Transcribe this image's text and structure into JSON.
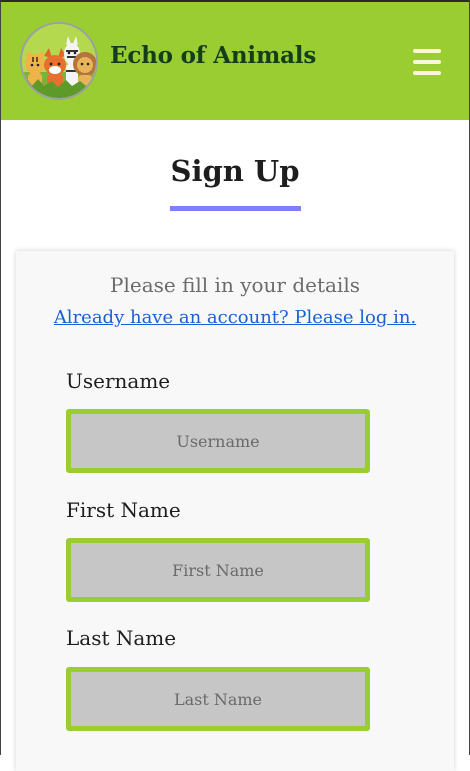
{
  "navbar": {
    "brand": "Echo of Animals",
    "logo_icon": "animals-logo-icon",
    "menu_icon": "hamburger-menu-icon",
    "color": "#9acd32"
  },
  "page": {
    "title": "Sign Up",
    "underline_color": "#7f7ff7"
  },
  "form": {
    "intro": "Please fill in your details",
    "login_link": "Already have an account? Please log in.",
    "fields": [
      {
        "label": "Username",
        "placeholder": "Username",
        "value": ""
      },
      {
        "label": "First Name",
        "placeholder": "First Name",
        "value": ""
      },
      {
        "label": "Last Name",
        "placeholder": "Last Name",
        "value": ""
      }
    ],
    "input_border_color": "#9acd32",
    "link_color": "#1a5fd6"
  }
}
